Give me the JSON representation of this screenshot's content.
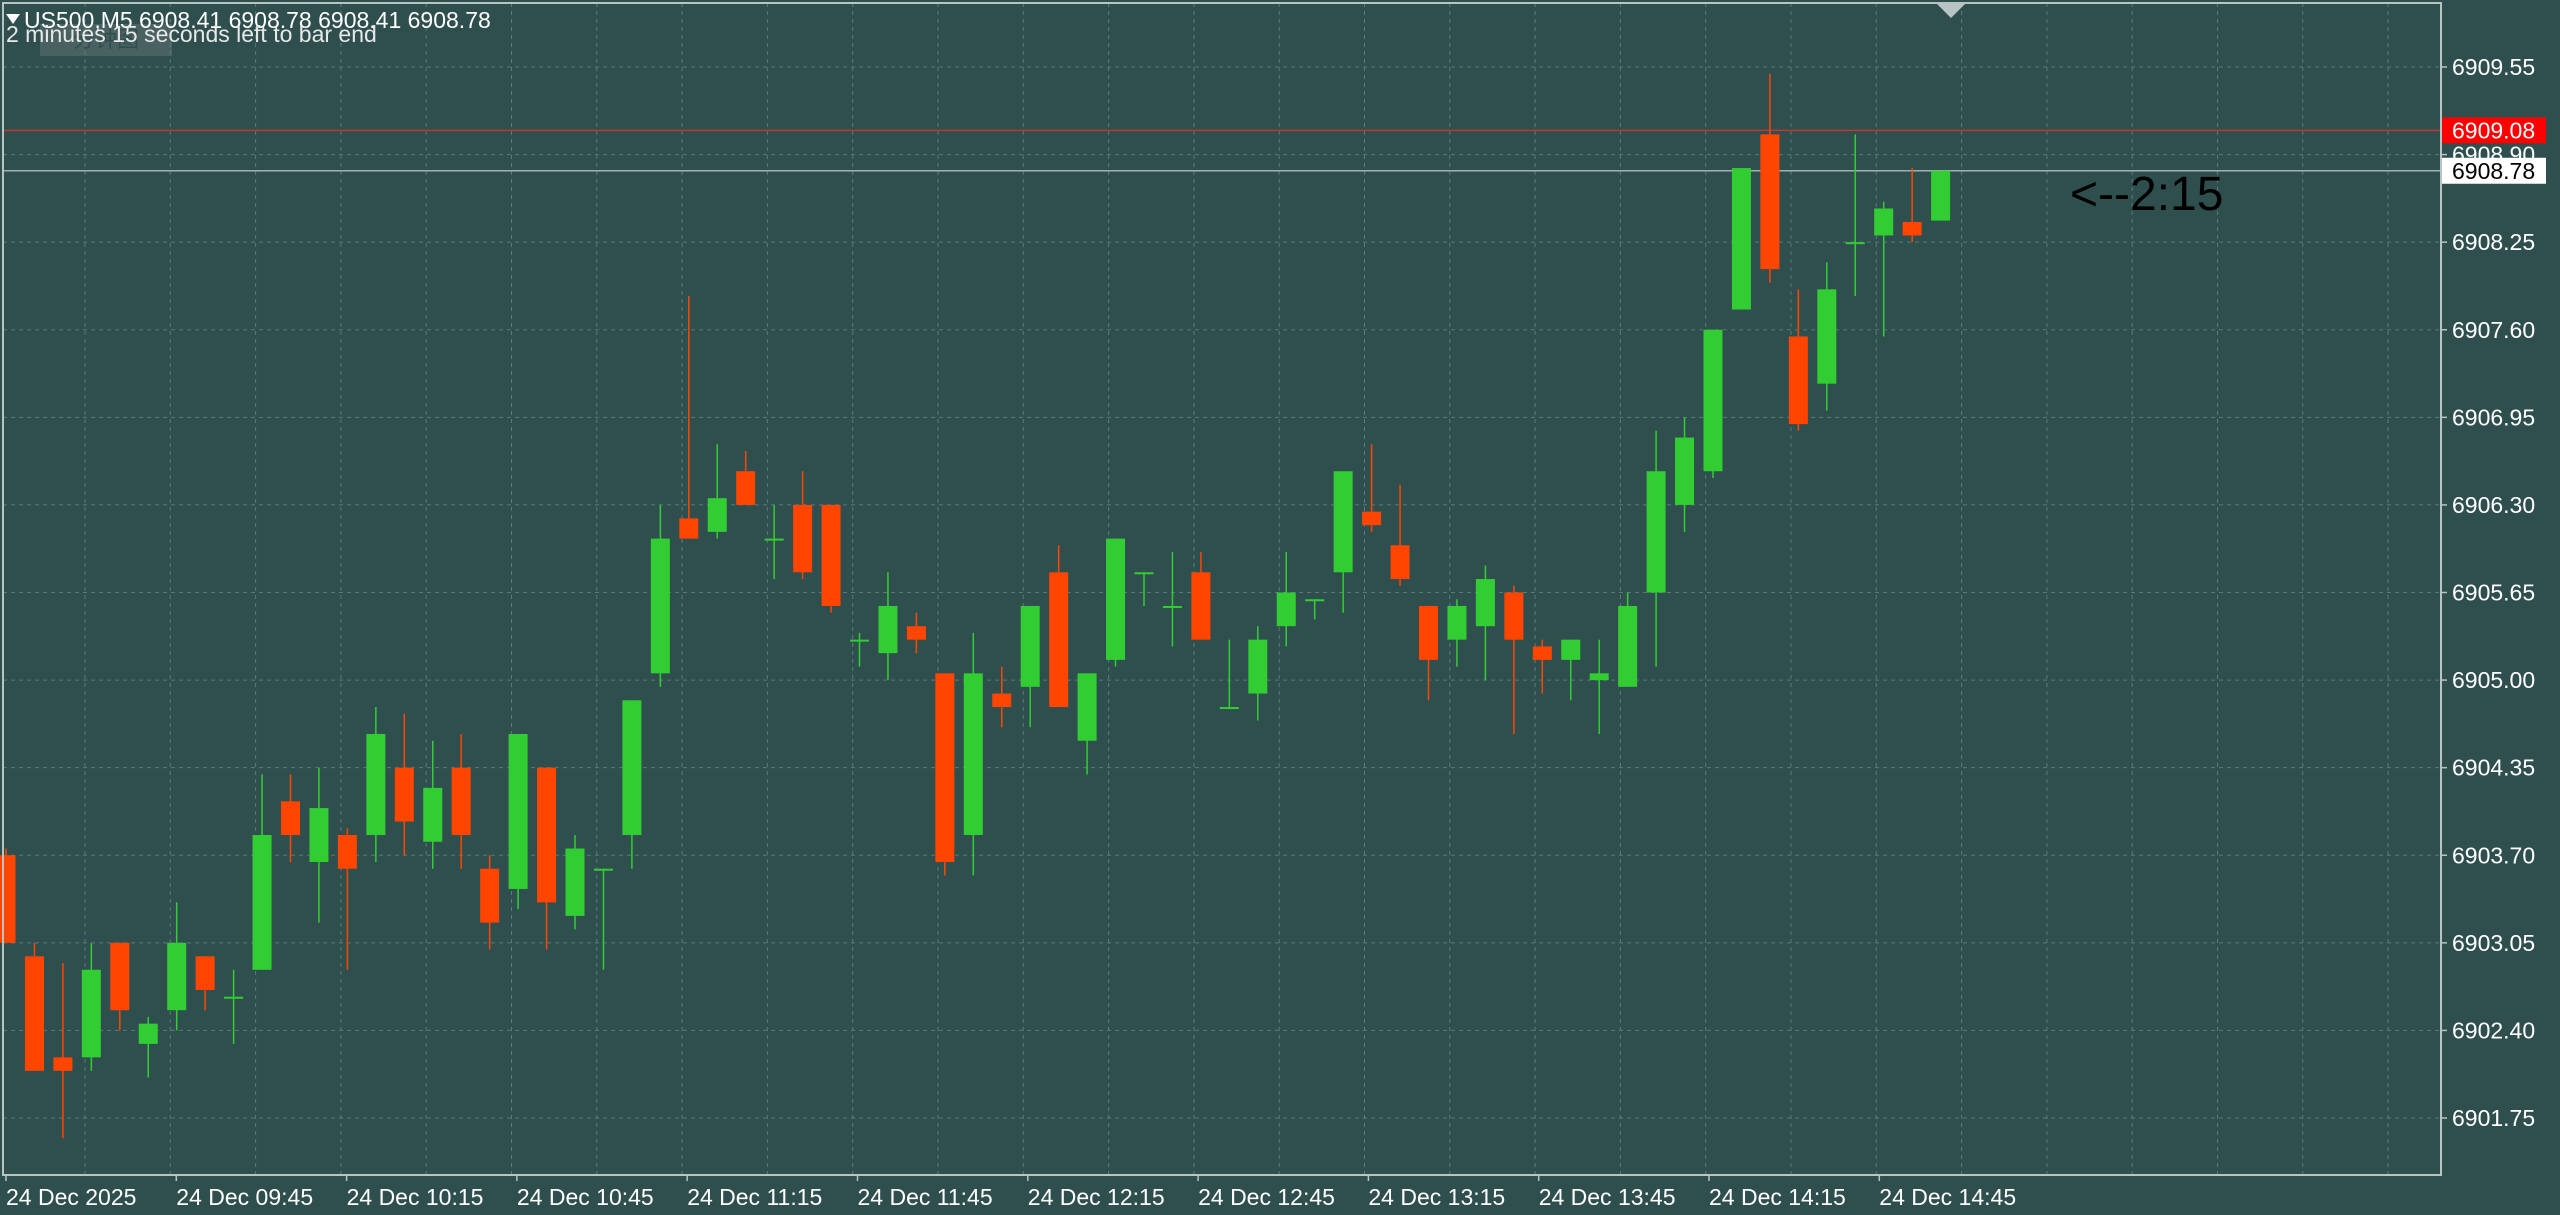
{
  "header": {
    "symbol_line": "US500,M5  6908.41 6908.78 6908.41 6908.78",
    "countdown_line": "2 minutes 15 seconds left to bar end",
    "overlay_label": "分钟图"
  },
  "countdown_label": "<--2:15",
  "colors": {
    "background": "#2f4f4f",
    "grid": "#5e7777",
    "bull": "#32cd32",
    "bear": "#ff4500",
    "text": "#ffffff",
    "ask_line": "#c0392b",
    "bid_line": "#9fb0b0",
    "ask_tag_bg": "#ff0000",
    "bid_tag_bg": "#ffffff",
    "bid_tag_text": "#000000"
  },
  "chart_data": {
    "type": "candlestick",
    "price_range": [
      6901.4,
      6910.0
    ],
    "y_ticks": [
      "6909.55",
      "6908.90",
      "6908.25",
      "6907.60",
      "6906.95",
      "6906.30",
      "6905.65",
      "6905.00",
      "6904.35",
      "6903.70",
      "6903.05",
      "6902.40",
      "6901.75"
    ],
    "x_labels": [
      "24 Dec 2025",
      "24 Dec 09:45",
      "24 Dec 10:15",
      "24 Dec 10:45",
      "24 Dec 11:15",
      "24 Dec 11:45",
      "24 Dec 12:15",
      "24 Dec 12:45",
      "24 Dec 13:15",
      "24 Dec 13:45",
      "24 Dec 14:15",
      "24 Dec 14:45"
    ],
    "ask_price": "6909.08",
    "bid_price": "6908.78",
    "candles": [
      {
        "o": 6903.7,
        "h": 6903.75,
        "l": 6903.05,
        "c": 6903.05
      },
      {
        "o": 6902.95,
        "h": 6903.05,
        "l": 6902.1,
        "c": 6902.1
      },
      {
        "o": 6902.2,
        "h": 6902.9,
        "l": 6901.6,
        "c": 6902.1
      },
      {
        "o": 6902.2,
        "h": 6903.05,
        "l": 6902.1,
        "c": 6902.85
      },
      {
        "o": 6903.05,
        "h": 6903.05,
        "l": 6902.4,
        "c": 6902.55
      },
      {
        "o": 6902.3,
        "h": 6902.5,
        "l": 6902.05,
        "c": 6902.45
      },
      {
        "o": 6902.55,
        "h": 6903.35,
        "l": 6902.4,
        "c": 6903.05
      },
      {
        "o": 6902.95,
        "h": 6902.95,
        "l": 6902.55,
        "c": 6902.7
      },
      {
        "o": 6902.65,
        "h": 6902.85,
        "l": 6902.3,
        "c": 6902.65
      },
      {
        "o": 6902.85,
        "h": 6904.3,
        "l": 6902.85,
        "c": 6903.85
      },
      {
        "o": 6904.1,
        "h": 6904.3,
        "l": 6903.65,
        "c": 6903.85
      },
      {
        "o": 6903.65,
        "h": 6904.35,
        "l": 6903.2,
        "c": 6904.05
      },
      {
        "o": 6903.85,
        "h": 6903.9,
        "l": 6902.85,
        "c": 6903.6
      },
      {
        "o": 6903.85,
        "h": 6904.8,
        "l": 6903.65,
        "c": 6904.6
      },
      {
        "o": 6904.35,
        "h": 6904.75,
        "l": 6903.7,
        "c": 6903.95
      },
      {
        "o": 6903.8,
        "h": 6904.55,
        "l": 6903.6,
        "c": 6904.2
      },
      {
        "o": 6904.35,
        "h": 6904.6,
        "l": 6903.6,
        "c": 6903.85
      },
      {
        "o": 6903.6,
        "h": 6903.7,
        "l": 6903.0,
        "c": 6903.2
      },
      {
        "o": 6903.45,
        "h": 6904.6,
        "l": 6903.3,
        "c": 6904.6
      },
      {
        "o": 6904.35,
        "h": 6904.35,
        "l": 6903.0,
        "c": 6903.35
      },
      {
        "o": 6903.25,
        "h": 6903.85,
        "l": 6903.15,
        "c": 6903.75
      },
      {
        "o": 6903.6,
        "h": 6903.6,
        "l": 6902.85,
        "c": 6903.6
      },
      {
        "o": 6903.85,
        "h": 6904.85,
        "l": 6903.6,
        "c": 6904.85
      },
      {
        "o": 6905.05,
        "h": 6906.3,
        "l": 6904.95,
        "c": 6906.05
      },
      {
        "o": 6906.2,
        "h": 6907.85,
        "l": 6906.05,
        "c": 6906.05
      },
      {
        "o": 6906.1,
        "h": 6906.75,
        "l": 6906.05,
        "c": 6906.35
      },
      {
        "o": 6906.55,
        "h": 6906.7,
        "l": 6906.3,
        "c": 6906.3
      },
      {
        "o": 6906.05,
        "h": 6906.3,
        "l": 6905.75,
        "c": 6906.05
      },
      {
        "o": 6906.3,
        "h": 6906.55,
        "l": 6905.75,
        "c": 6905.8
      },
      {
        "o": 6906.3,
        "h": 6906.3,
        "l": 6905.5,
        "c": 6905.55
      },
      {
        "o": 6905.3,
        "h": 6905.35,
        "l": 6905.1,
        "c": 6905.3
      },
      {
        "o": 6905.2,
        "h": 6905.8,
        "l": 6905.0,
        "c": 6905.55
      },
      {
        "o": 6905.4,
        "h": 6905.5,
        "l": 6905.2,
        "c": 6905.3
      },
      {
        "o": 6905.05,
        "h": 6905.05,
        "l": 6903.55,
        "c": 6903.65
      },
      {
        "o": 6903.85,
        "h": 6905.35,
        "l": 6903.55,
        "c": 6905.05
      },
      {
        "o": 6904.9,
        "h": 6905.1,
        "l": 6904.65,
        "c": 6904.8
      },
      {
        "o": 6904.95,
        "h": 6905.55,
        "l": 6904.65,
        "c": 6905.55
      },
      {
        "o": 6905.8,
        "h": 6906.0,
        "l": 6904.9,
        "c": 6904.8
      },
      {
        "o": 6904.55,
        "h": 6905.0,
        "l": 6904.3,
        "c": 6905.05
      },
      {
        "o": 6905.15,
        "h": 6906.05,
        "l": 6905.1,
        "c": 6906.05
      },
      {
        "o": 6905.8,
        "h": 6905.8,
        "l": 6905.55,
        "c": 6905.8
      },
      {
        "o": 6905.55,
        "h": 6905.95,
        "l": 6905.25,
        "c": 6905.55
      },
      {
        "o": 6905.8,
        "h": 6905.95,
        "l": 6905.55,
        "c": 6905.3
      },
      {
        "o": 6904.8,
        "h": 6905.3,
        "l": 6904.8,
        "c": 6904.8
      },
      {
        "o": 6904.9,
        "h": 6905.4,
        "l": 6904.7,
        "c": 6905.3
      },
      {
        "o": 6905.4,
        "h": 6905.95,
        "l": 6905.25,
        "c": 6905.65
      },
      {
        "o": 6905.6,
        "h": 6905.6,
        "l": 6905.45,
        "c": 6905.6
      },
      {
        "o": 6905.8,
        "h": 6906.55,
        "l": 6905.5,
        "c": 6906.55
      },
      {
        "o": 6906.25,
        "h": 6906.75,
        "l": 6906.1,
        "c": 6906.15
      },
      {
        "o": 6906.0,
        "h": 6906.45,
        "l": 6905.7,
        "c": 6905.75
      },
      {
        "o": 6905.55,
        "h": 6905.55,
        "l": 6904.85,
        "c": 6905.15
      },
      {
        "o": 6905.3,
        "h": 6905.6,
        "l": 6905.1,
        "c": 6905.55
      },
      {
        "o": 6905.4,
        "h": 6905.85,
        "l": 6905.0,
        "c": 6905.75
      },
      {
        "o": 6905.65,
        "h": 6905.7,
        "l": 6904.6,
        "c": 6905.3
      },
      {
        "o": 6905.25,
        "h": 6905.3,
        "l": 6904.9,
        "c": 6905.15
      },
      {
        "o": 6905.15,
        "h": 6905.3,
        "l": 6904.85,
        "c": 6905.3
      },
      {
        "o": 6905.0,
        "h": 6905.3,
        "l": 6904.6,
        "c": 6905.05
      },
      {
        "o": 6904.95,
        "h": 6905.65,
        "l": 6904.95,
        "c": 6905.55
      },
      {
        "o": 6905.65,
        "h": 6906.85,
        "l": 6905.1,
        "c": 6906.55
      },
      {
        "o": 6906.3,
        "h": 6906.95,
        "l": 6906.1,
        "c": 6906.8
      },
      {
        "o": 6906.55,
        "h": 6907.6,
        "l": 6906.5,
        "c": 6907.6
      },
      {
        "o": 6907.75,
        "h": 6908.8,
        "l": 6907.75,
        "c": 6908.8
      },
      {
        "o": 6909.05,
        "h": 6909.5,
        "l": 6907.95,
        "c": 6908.05
      },
      {
        "o": 6907.55,
        "h": 6907.9,
        "l": 6906.85,
        "c": 6906.9
      },
      {
        "o": 6907.2,
        "h": 6908.1,
        "l": 6907.0,
        "c": 6907.9
      },
      {
        "o": 6908.25,
        "h": 6909.05,
        "l": 6907.85,
        "c": 6908.25
      },
      {
        "o": 6908.3,
        "h": 6908.55,
        "l": 6907.55,
        "c": 6908.5
      },
      {
        "o": 6908.4,
        "h": 6908.8,
        "l": 6908.25,
        "c": 6908.3
      },
      {
        "o": 6908.41,
        "h": 6908.78,
        "l": 6908.41,
        "c": 6908.78
      }
    ]
  }
}
